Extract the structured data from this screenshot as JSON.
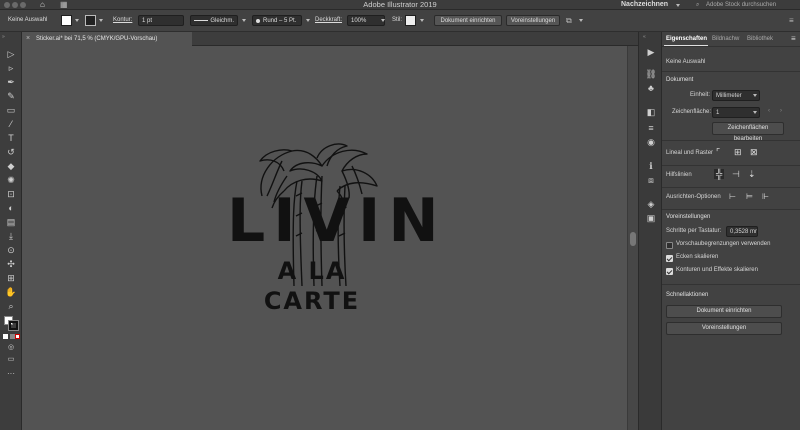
{
  "app": {
    "title": "Adobe Illustrator 2019",
    "workspace": "Nachzeichnen",
    "stock_search_placeholder": "Adobe Stock durchsuchen"
  },
  "control_bar": {
    "selection": "Keine Auswahl",
    "stroke_label": "Kontur:",
    "stroke_weight": "1 pt",
    "stroke_profile": "Gleichm.",
    "brush": "Rund – 5 Pt.",
    "opacity_label": "Deckkraft:",
    "opacity_value": "100%",
    "style_label": "Stil:",
    "doc_setup": "Dokument einrichten",
    "preferences": "Voreinstellungen"
  },
  "document_tab": {
    "label": "Sticker.ai* bei 71,5 % (CMYK/GPU-Vorschau)"
  },
  "artwork": {
    "line1": "LIVIN",
    "line2": "A LA CARTE"
  },
  "panel": {
    "tabs": [
      "Eigenschaften",
      "Bildnachw",
      "Bibliothek"
    ],
    "no_selection": "Keine Auswahl",
    "document_header": "Dokument",
    "unit_label": "Einheit:",
    "unit_value": "Millimeter",
    "artboard_label": "Zeichenfläche:",
    "artboard_value": "1",
    "edit_artboards": "Zeichenflächen bearbeiten",
    "rulers_grid": "Lineal und Raster",
    "guides": "Hilfslinien",
    "align_options": "Ausrichten-Optionen",
    "prefs_header": "Voreinstellungen",
    "keyboard_increment_label": "Schritte per Tastatur:",
    "keyboard_increment_value": "0,3528 mr",
    "cb_preview_bounds": "Vorschaubegrenzungen verwenden",
    "cb_scale_corners": "Ecken skalieren",
    "cb_scale_strokes": "Konturen und Effekte skalieren",
    "quick_actions": "Schnellaktionen",
    "btn_doc_setup": "Dokument einrichten",
    "btn_preferences": "Voreinstellungen"
  },
  "checkboxes": {
    "preview_bounds": false,
    "scale_corners": true,
    "scale_strokes": true
  },
  "colors": {
    "ui_dark": "#3c3c3c",
    "canvas": "#535353",
    "panel": "#424242",
    "artwork": "#111111",
    "active_tab_underline": "#e0e0e0"
  }
}
